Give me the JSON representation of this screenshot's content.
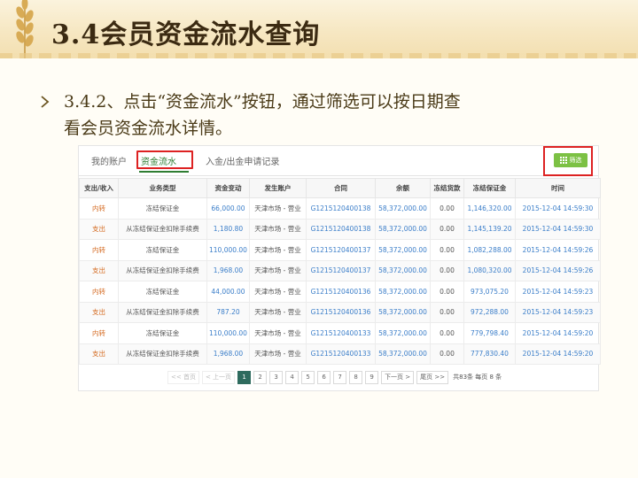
{
  "slide": {
    "title": "3.4会员资金流水查询",
    "bullet_line1": "3.4.2、点击“资金流水”按钮，通过筛选可以按日期查",
    "bullet_line2": "看会员资金流水详情。"
  },
  "colors": {
    "accent_green": "#2e7d32",
    "filter_button": "#7cc144",
    "highlight_red": "#dd2222",
    "direction_text": "#d4691f",
    "link_blue": "#3b7ec9"
  },
  "tabs": [
    {
      "label": "我的账户"
    },
    {
      "label": "资金流水",
      "active": true
    },
    {
      "label": "入金/出金申请记录"
    }
  ],
  "filter_button": {
    "label": "筛选",
    "icon": "grid-icon"
  },
  "table": {
    "headers": [
      "支出/收入",
      "业务类型",
      "资金变动",
      "发生账户",
      "合同",
      "余额",
      "冻结货款",
      "冻结保证金",
      "时间"
    ],
    "rows": [
      [
        "内转",
        "冻结保证金",
        "66,000.00",
        "天津市场 - 营业",
        "G1215120400138",
        "58,372,000.00",
        "0.00",
        "1,146,320.00",
        "2015-12-04 14:59:30"
      ],
      [
        "支出",
        "从冻结保证金扣除手续费",
        "1,180.80",
        "天津市场 - 营业",
        "G1215120400138",
        "58,372,000.00",
        "0.00",
        "1,145,139.20",
        "2015-12-04 14:59:30"
      ],
      [
        "内转",
        "冻结保证金",
        "110,000.00",
        "天津市场 - 营业",
        "G1215120400137",
        "58,372,000.00",
        "0.00",
        "1,082,288.00",
        "2015-12-04 14:59:26"
      ],
      [
        "支出",
        "从冻结保证金扣除手续费",
        "1,968.00",
        "天津市场 - 营业",
        "G1215120400137",
        "58,372,000.00",
        "0.00",
        "1,080,320.00",
        "2015-12-04 14:59:26"
      ],
      [
        "内转",
        "冻结保证金",
        "44,000.00",
        "天津市场 - 营业",
        "G1215120400136",
        "58,372,000.00",
        "0.00",
        "973,075.20",
        "2015-12-04 14:59:23"
      ],
      [
        "支出",
        "从冻结保证金扣除手续费",
        "787.20",
        "天津市场 - 营业",
        "G1215120400136",
        "58,372,000.00",
        "0.00",
        "972,288.00",
        "2015-12-04 14:59:23"
      ],
      [
        "内转",
        "冻结保证金",
        "110,000.00",
        "天津市场 - 营业",
        "G1215120400133",
        "58,372,000.00",
        "0.00",
        "779,798.40",
        "2015-12-04 14:59:20"
      ],
      [
        "支出",
        "从冻结保证金扣除手续费",
        "1,968.00",
        "天津市场 - 营业",
        "G1215120400133",
        "58,372,000.00",
        "0.00",
        "777,830.40",
        "2015-12-04 14:59:20"
      ]
    ]
  },
  "pager": {
    "first": "<< 首页",
    "prev": "< 上一页",
    "pages": [
      "1",
      "2",
      "3",
      "4",
      "5",
      "6",
      "7",
      "8",
      "9"
    ],
    "current": "1",
    "next": "下一页 >",
    "last": "尾页 >>",
    "info": "共83条 每页 8 条"
  }
}
